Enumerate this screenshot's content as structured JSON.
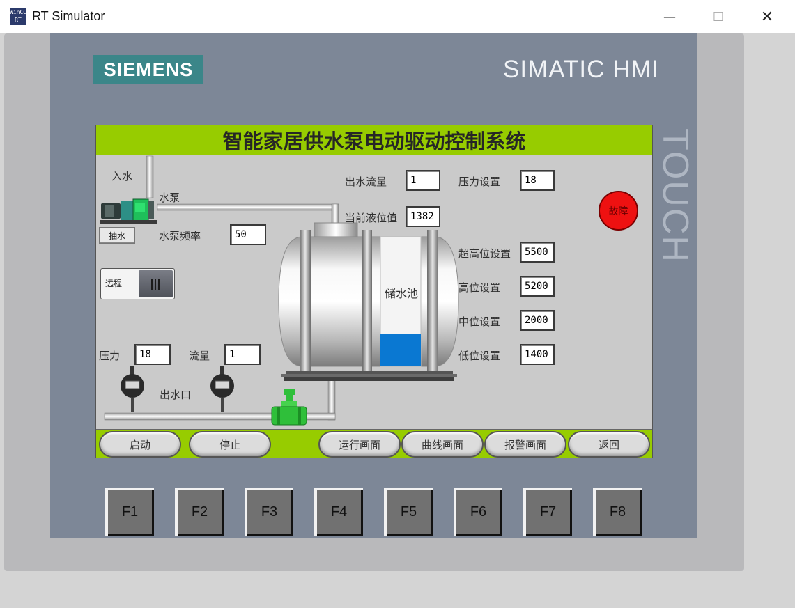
{
  "window": {
    "app_icon": "WinCC RT",
    "title": "RT Simulator",
    "minimize_icon": "minimize-icon",
    "maximize_icon": "maximize-icon",
    "close_icon": "close-icon"
  },
  "panel": {
    "brand": "SIEMENS",
    "model": "SIMATIC HMI",
    "touch_label": "TOUCH"
  },
  "screen": {
    "title": "智能家居供水泵电动驱动控制系统",
    "inlet_label": "入水",
    "pump_label": "水泵",
    "pump_button": "抽水",
    "pump_freq_label": "水泵频率",
    "pump_freq_value": "50",
    "mode_switch_label": "远程",
    "pressure_label": "压力",
    "pressure_value": "18",
    "flow_label": "流量",
    "flow_value": "1",
    "outlet_label": "出水口",
    "outflow_label": "出水流量",
    "outflow_value": "1",
    "pressure_set_label": "压力设置",
    "pressure_set_value": "18",
    "level_label": "当前液位值",
    "level_value": "1382",
    "tank_label": "储水池",
    "tank_fill_fraction": 0.25,
    "fault_label": "故障",
    "setpoints": [
      {
        "label": "超高位设置",
        "value": "5500"
      },
      {
        "label": "高位设置",
        "value": "5200"
      },
      {
        "label": "中位设置",
        "value": "2000"
      },
      {
        "label": "低位设置",
        "value": "1400"
      }
    ],
    "buttons": {
      "start": "启动",
      "stop": "停止",
      "run_screen": "运行画面",
      "trend_screen": "曲线画面",
      "alarm_screen": "报警画面",
      "back": "返回"
    }
  },
  "function_keys": [
    "F1",
    "F2",
    "F3",
    "F4",
    "F5",
    "F6",
    "F7",
    "F8"
  ],
  "colors": {
    "title_bar_green": "#97cc00",
    "siemens_teal": "#3b8689",
    "panel_slate": "#7d8797",
    "fault_red": "#ee1111",
    "water_blue": "#0a78d2"
  }
}
